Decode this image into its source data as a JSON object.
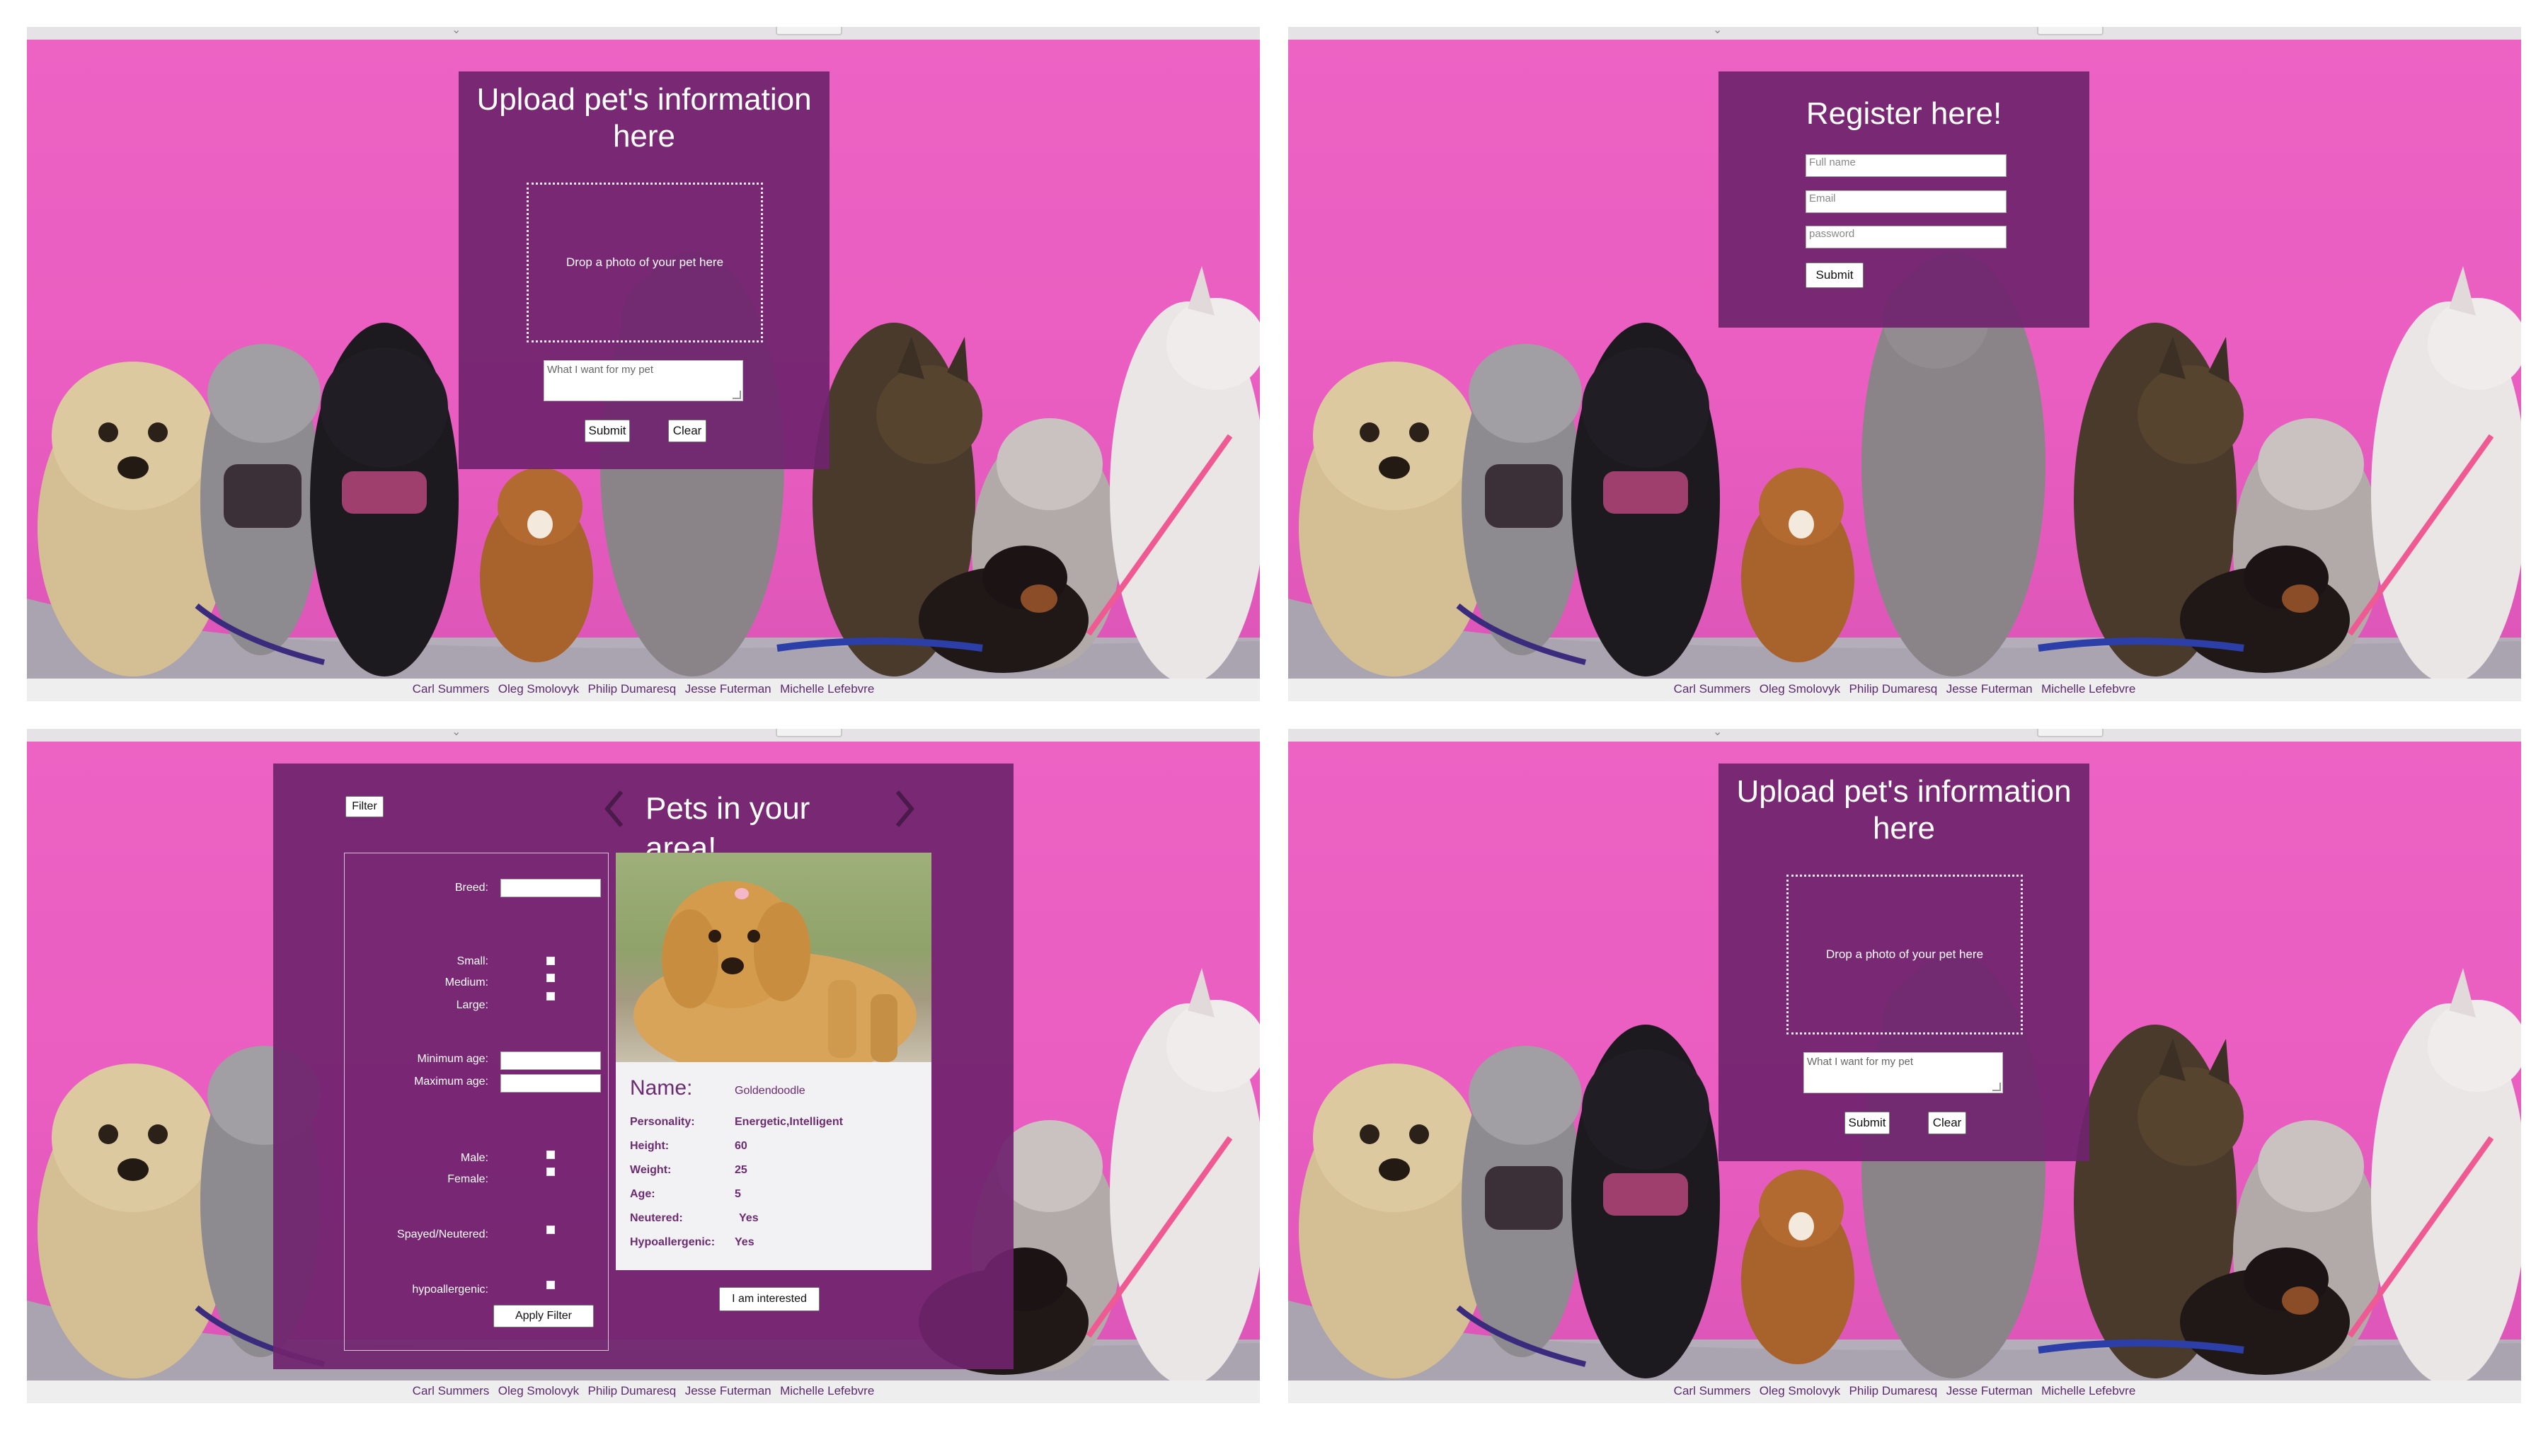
{
  "credits": [
    "Carl Summers",
    "Oleg Smolovyk",
    "Philip Dumaresq",
    "Jesse Futerman",
    "Michelle Lefebvre"
  ],
  "upload_form": {
    "title": "Upload pet's information here",
    "dropzone_text": "Drop a photo of your pet here",
    "textarea_placeholder": "What I want for my pet",
    "submit_label": "Submit",
    "clear_label": "Clear"
  },
  "register_form": {
    "title": "Register here!",
    "fullname_placeholder": "Full name",
    "email_placeholder": "Email",
    "password_placeholder": "password",
    "submit_label": "Submit"
  },
  "pets_page": {
    "title": "Pets in your area!",
    "filter_button": "Filter",
    "filters": {
      "breed_label": "Breed:",
      "small_label": "Small:",
      "medium_label": "Medium:",
      "large_label": "Large:",
      "min_age_label": "Minimum age:",
      "max_age_label": "Maximum age:",
      "male_label": "Male:",
      "female_label": "Female:",
      "spayed_label": "Spayed/Neutered:",
      "hypo_label": "hypoallergenic:",
      "apply_label": "Apply Filter"
    },
    "pet": {
      "name_label": "Name:",
      "name": "Goldendoodle",
      "personality_label": "Personality:",
      "personality": "Energetic,Intelligent",
      "height_label": "Height:",
      "height": "60",
      "weight_label": "Weight:",
      "weight": "25",
      "age_label": "Age:",
      "age": "5",
      "neutered_label": "Neutered:",
      "neutered": "Yes",
      "hypo_label": "Hypoallergenic:",
      "hypo": "Yes"
    },
    "interested_label": "I am interested",
    "prev_icon": "chevron-left-icon",
    "next_icon": "chevron-right-icon"
  },
  "colors": {
    "background_pink": "#ea60c2",
    "card_purple": "#70236e",
    "text_purple": "#6b2c72"
  }
}
